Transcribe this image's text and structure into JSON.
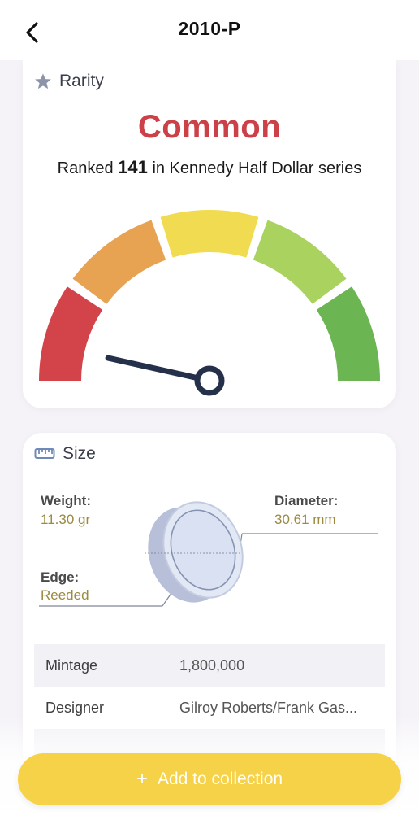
{
  "header": {
    "title": "2010-P",
    "back_icon": "chevron-left-icon"
  },
  "rarity": {
    "section_label": "Rarity",
    "section_icon": "star-icon",
    "value": "Common",
    "value_color": "#cc4147",
    "rank_prefix": "Ranked",
    "rank_number": "141",
    "rank_suffix": "in Kennedy Half Dollar series",
    "gauge": {
      "segment_colors": [
        "#d3434a",
        "#e8a352",
        "#f1db50",
        "#a9d35e",
        "#6bb552"
      ],
      "needle_level": 0.07
    }
  },
  "size": {
    "section_label": "Size",
    "section_icon": "ruler-icon",
    "weight_label": "Weight:",
    "weight_value": "11.30 gr",
    "diameter_label": "Diameter:",
    "diameter_value": "30.61 mm",
    "edge_label": "Edge:",
    "edge_value": "Reeded"
  },
  "details": {
    "rows": [
      {
        "key": "Mintage",
        "value": "1,800,000"
      },
      {
        "key": "Designer",
        "value": "Gilroy Roberts/Frank Gas..."
      }
    ]
  },
  "actions": {
    "add_label": "Add to collection",
    "add_icon": "plus-icon",
    "add_color": "#f6d249"
  }
}
